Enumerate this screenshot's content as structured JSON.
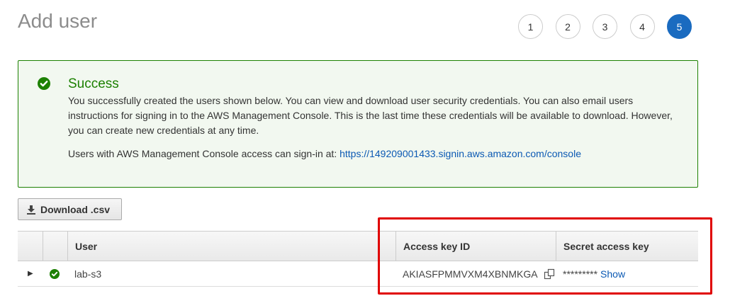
{
  "page": {
    "title": "Add user"
  },
  "steps": [
    {
      "label": "1",
      "active": false
    },
    {
      "label": "2",
      "active": false
    },
    {
      "label": "3",
      "active": false
    },
    {
      "label": "4",
      "active": false
    },
    {
      "label": "5",
      "active": true
    }
  ],
  "success": {
    "title": "Success",
    "message": "You successfully created the users shown below. You can view and download user security credentials. You can also email users instructions for signing in to the AWS Management Console. This is the last time these credentials will be available to download. However, you can create new credentials at any time.",
    "console_prefix": "Users with AWS Management Console access can sign-in at:",
    "console_url": "https://149209001433.signin.aws.amazon.com/console"
  },
  "toolbar": {
    "download_label": "Download .csv"
  },
  "table": {
    "headers": {
      "user": "User",
      "access_key_id": "Access key ID",
      "secret_access_key": "Secret access key"
    },
    "rows": [
      {
        "user": "lab-s3",
        "access_key_id": "AKIASFPMMVXM4XBNMKGA",
        "secret_masked": "*********",
        "show_label": "Show"
      }
    ]
  },
  "colors": {
    "success_green": "#1d8102",
    "link_blue": "#0b59b3",
    "active_step": "#1a6bc0",
    "highlight_red": "#e00000"
  }
}
